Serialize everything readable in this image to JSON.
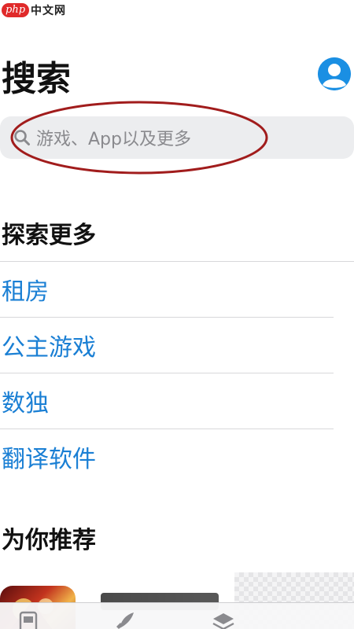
{
  "watermark": {
    "logo": "php",
    "text": "中文网"
  },
  "header": {
    "title": "搜索",
    "avatar_icon": "person-circle-icon"
  },
  "search": {
    "placeholder": "游戏、App以及更多",
    "icon": "magnifier-icon"
  },
  "explore": {
    "title": "探索更多",
    "items": [
      {
        "label": "租房"
      },
      {
        "label": "公主游戏"
      },
      {
        "label": "数独"
      },
      {
        "label": "翻译软件"
      }
    ]
  },
  "recommended": {
    "title": "为你推荐"
  },
  "tabbar": {
    "tabs": [
      {
        "icon": "today-icon"
      },
      {
        "icon": "rocket-icon"
      },
      {
        "icon": "layers-icon"
      }
    ]
  },
  "colors": {
    "accent": "#1a7fd4",
    "avatar": "#1a8fe3",
    "annotation": "#a11c1c",
    "search_bg": "#ecedef"
  }
}
